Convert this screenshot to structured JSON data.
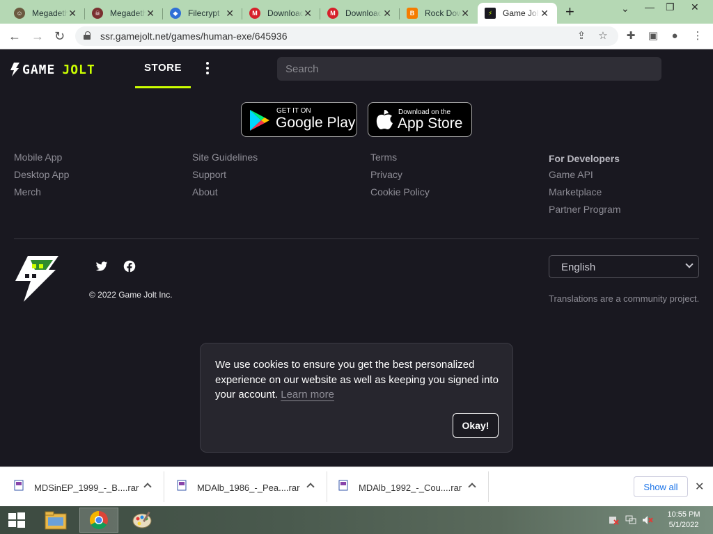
{
  "browser": {
    "tabs": [
      {
        "title": "Megadeth",
        "favicon_color": "#6b5a40",
        "favicon_glyph": "☺"
      },
      {
        "title": "Megadeth",
        "favicon_color": "#7a3030",
        "favicon_glyph": "☠"
      },
      {
        "title": "Filecrypt",
        "favicon_color": "#2f6fd6",
        "favicon_glyph": "◆"
      },
      {
        "title": "Download",
        "favicon_color": "#d6202a",
        "favicon_glyph": "M"
      },
      {
        "title": "Download",
        "favicon_color": "#d6202a",
        "favicon_glyph": "M"
      },
      {
        "title": "Rock Down",
        "favicon_color": "#f57c00",
        "favicon_glyph": "B"
      },
      {
        "title": "Game Jolt",
        "favicon_color": "#191820",
        "favicon_glyph": "⚡"
      }
    ],
    "new_tab": "+",
    "url": "ssr.gamejolt.net/games/human-exe/645936"
  },
  "site": {
    "logo_word1": "GAME",
    "logo_word2": "JOLT",
    "store_label": "STORE",
    "search_placeholder": "Search",
    "badges": {
      "google": {
        "small": "GET IT ON",
        "big": "Google Play"
      },
      "apple": {
        "small": "Download on the",
        "big": "App Store"
      }
    },
    "footer": {
      "col1": [
        "Mobile App",
        "Desktop App",
        "Merch"
      ],
      "col2": [
        "Site Guidelines",
        "Support",
        "About"
      ],
      "col3": [
        "Terms",
        "Privacy",
        "Cookie Policy"
      ],
      "col4_head": "For Developers",
      "col4": [
        "Game API",
        "Marketplace",
        "Partner Program"
      ]
    },
    "copyright": "© 2022 Game Jolt Inc.",
    "language": "English",
    "translations_note": "Translations are a community project.",
    "accent_color": "#ccff00"
  },
  "cookie": {
    "message": "We use cookies to ensure you get the best personalized experience on our website as well as keeping you signed into your account.",
    "learn_more": "Learn more",
    "okay": "Okay!"
  },
  "downloads": {
    "items": [
      "MDSinEP_1999_-_B....rar",
      "MDAlb_1986_-_Pea....rar",
      "MDAlb_1992_-_Cou....rar"
    ],
    "show_all": "Show all"
  },
  "taskbar": {
    "time": "10:55 PM",
    "date": "5/1/2022"
  }
}
